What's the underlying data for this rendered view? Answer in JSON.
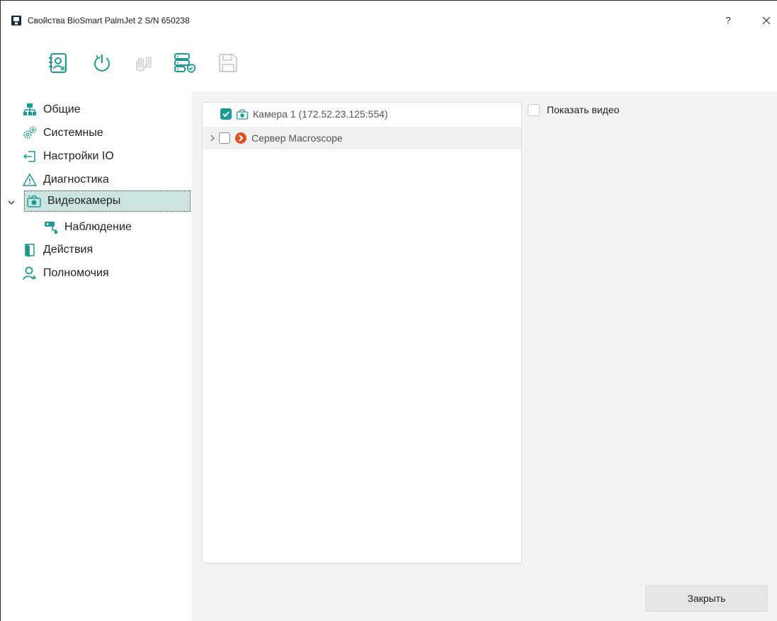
{
  "window": {
    "title": "Свойства BioSmart PalmJet 2 S/N 650238",
    "help_label": "?"
  },
  "toolbar": {
    "buttons": [
      {
        "icon": "user-profile-icon",
        "enabled": true
      },
      {
        "icon": "power-restart-icon",
        "enabled": true
      },
      {
        "icon": "palm-scan-icon",
        "enabled": false
      },
      {
        "icon": "server-settings-icon",
        "enabled": true
      },
      {
        "icon": "save-icon",
        "enabled": false
      }
    ]
  },
  "sidebar": {
    "items": [
      {
        "label": "Общие",
        "icon": "network-icon"
      },
      {
        "label": "Системные",
        "icon": "gears-icon"
      },
      {
        "label": "Настройки IO",
        "icon": "login-arrow-icon"
      },
      {
        "label": "Диагностика",
        "icon": "warning-icon"
      },
      {
        "label": "Видеокамеры",
        "icon": "camera-icon",
        "selected": true,
        "expanded": true
      },
      {
        "label": "Наблюдение",
        "icon": "surveillance-camera-icon",
        "child": true
      },
      {
        "label": "Действия",
        "icon": "door-icon"
      },
      {
        "label": "Полномочия",
        "icon": "add-user-icon"
      }
    ]
  },
  "tree": {
    "rows": [
      {
        "label": "Камера 1 (172.52.23.125:554)",
        "checked": true,
        "icon": "camera-icon",
        "expandable": false
      },
      {
        "label": "Сервер Macroscope",
        "checked": false,
        "icon": "macroscope-server-icon",
        "expandable": true
      }
    ]
  },
  "show_video": {
    "label": "Показать видео",
    "checked": false
  },
  "footer": {
    "close_label": "Закрыть"
  },
  "colors": {
    "accent": "#1a9b93",
    "selected_bg": "#cbe4e2",
    "macroscope": "#e0501e"
  }
}
